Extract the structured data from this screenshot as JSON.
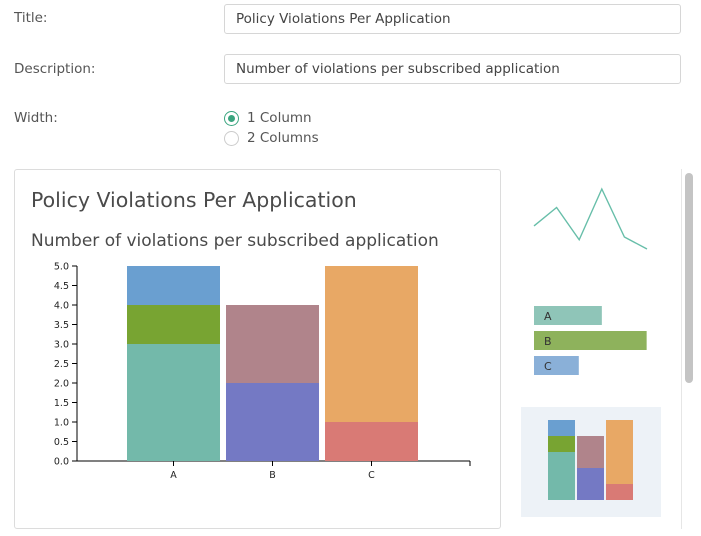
{
  "form": {
    "title_label": "Title:",
    "title_value": "Policy Violations Per Application",
    "description_label": "Description:",
    "description_value": "Number of violations per subscribed application",
    "width_label": "Width:",
    "width_options": [
      "1 Column",
      "2 Columns"
    ],
    "width_selected": "1 Column"
  },
  "colors": {
    "accent": "#3aa57f",
    "series": [
      "#73b9aa",
      "#78a432",
      "#6a9fd0",
      "#b0848b",
      "#7479c4",
      "#e8a865",
      "#d97a75"
    ]
  },
  "preview": {
    "title": "Policy Violations Per Application",
    "subtitle": "Number of violations per subscribed application"
  },
  "chart_data": {
    "type": "bar",
    "stacked": true,
    "categories": [
      "A",
      "B",
      "C"
    ],
    "ylim": [
      0,
      5
    ],
    "yticks": [
      "0.0",
      "0.5",
      "1.0",
      "1.5",
      "2.0",
      "2.5",
      "3.0",
      "3.5",
      "4.0",
      "4.5",
      "5.0"
    ],
    "stacks": [
      {
        "category": "A",
        "segments": [
          {
            "value": 3,
            "color": "#73b9aa"
          },
          {
            "value": 1,
            "color": "#78a432"
          },
          {
            "value": 1,
            "color": "#6a9fd0"
          }
        ]
      },
      {
        "category": "B",
        "segments": [
          {
            "value": 2,
            "color": "#7479c4"
          },
          {
            "value": 2,
            "color": "#b0848b"
          }
        ]
      },
      {
        "category": "C",
        "segments": [
          {
            "value": 1,
            "color": "#d97a75"
          },
          {
            "value": 4,
            "color": "#e8a865"
          }
        ]
      }
    ]
  },
  "gallery": {
    "line_thumb": {
      "icon": "line-chart-icon",
      "values": [
        3,
        5,
        1.5,
        7,
        1.8,
        0.5
      ]
    },
    "hbar_thumb": {
      "icon": "horizontal-bar-chart-icon",
      "bars": [
        {
          "label": "A",
          "value": 0.53,
          "color": "#8fc5b8"
        },
        {
          "label": "B",
          "value": 0.88,
          "color": "#8eb25c"
        },
        {
          "label": "C",
          "value": 0.35,
          "color": "#8ab0d8"
        }
      ]
    },
    "stacked_thumb": {
      "icon": "stacked-bar-chart-icon",
      "selected": true
    }
  }
}
